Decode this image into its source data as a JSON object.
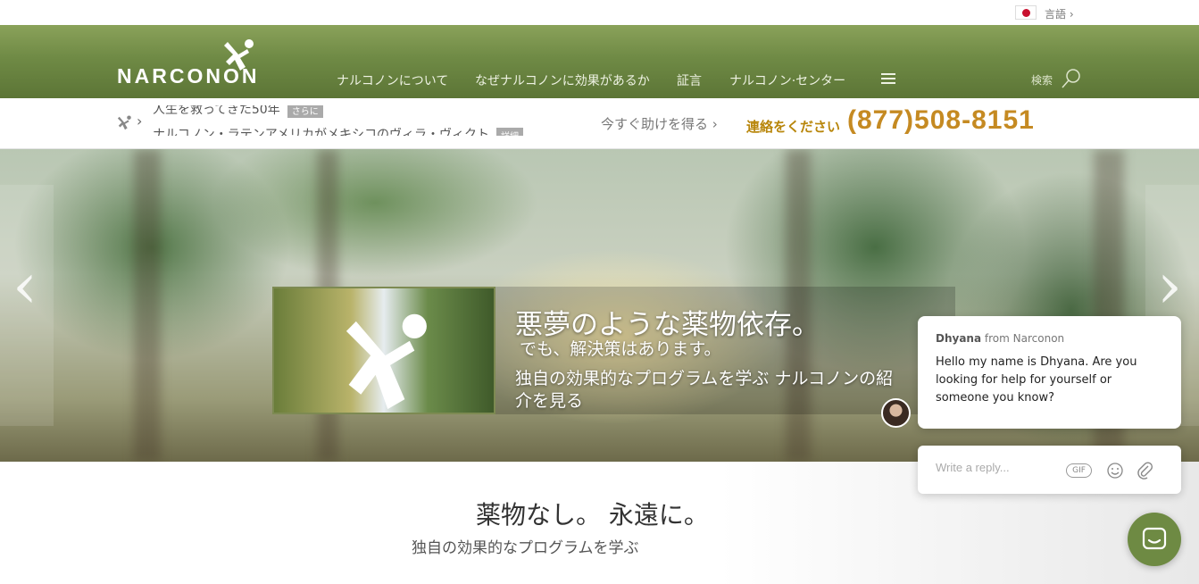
{
  "language": {
    "label": "言語 ›",
    "flag_icon": "japan-flag-icon"
  },
  "header": {
    "logo_text": "NARCONON",
    "nav": [
      "ナルコノンについて",
      "なぜナルコノンに効果があるか",
      "証言",
      "ナルコノン·センター"
    ],
    "search_label": "検索",
    "brand_color": "#6f8a45"
  },
  "strip": {
    "news": [
      {
        "text": "人生を救ってきた50年",
        "badge": "さらに"
      },
      {
        "text": "ナルコノン・ラテンアメリカがメキシコのヴィラ・ヴィクト",
        "badge": "詳細"
      }
    ],
    "help_link": "今すぐ助けを得る ›",
    "contact_label": "連絡をください",
    "phone": "(877)508-8151",
    "accent_color": "#c58a22"
  },
  "hero": {
    "prev_arrow": "‹",
    "next_arrow": "›",
    "title": "悪夢のような薬物依存。",
    "subtitle": "でも、解決策はあります。",
    "link": "独自の効果的なプログラムを学ぶ ナルコノンの紹介を見る"
  },
  "lower": {
    "tagline": "薬物なし。 永遠に。",
    "sub": "独自の効果的なプログラムを学ぶ"
  },
  "chat": {
    "agent_name": "Dhyana",
    "from_text": "from Narconon",
    "message": "Hello my name is Dhyana. Are you looking for help for yourself or someone you know?",
    "reply_placeholder": "Write a reply...",
    "gif_label": "GIF"
  }
}
